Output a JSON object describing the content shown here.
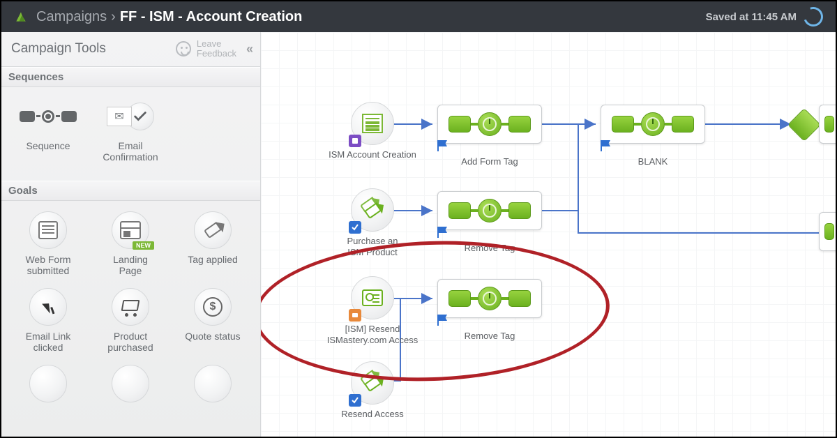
{
  "header": {
    "breadcrumb_root": "Campaigns",
    "breadcrumb_sep": "›",
    "title": "FF - ISM - Account Creation",
    "saved_text": "Saved at 11:45 AM"
  },
  "sidebar": {
    "title": "Campaign Tools",
    "feedback_label": "Leave\nFeedback",
    "sections": {
      "sequences": {
        "label": "Sequences",
        "items": [
          {
            "name": "sequence",
            "label": "Sequence"
          },
          {
            "name": "email-confirmation",
            "label": "Email\nConfirmation"
          }
        ]
      },
      "goals": {
        "label": "Goals",
        "items": [
          {
            "name": "web-form-submitted",
            "label": "Web Form\nsubmitted"
          },
          {
            "name": "landing-page",
            "label": "Landing\nPage",
            "badge": "NEW"
          },
          {
            "name": "tag-applied",
            "label": "Tag applied"
          },
          {
            "name": "email-link-clicked",
            "label": "Email Link\nclicked"
          },
          {
            "name": "product-purchased",
            "label": "Product\npurchased"
          },
          {
            "name": "quote-status",
            "label": "Quote status"
          }
        ]
      }
    }
  },
  "canvas": {
    "nodes": {
      "ism_account_creation": {
        "label": "ISM Account Creation",
        "badge": "purple"
      },
      "add_form_tag": {
        "label": "Add Form Tag"
      },
      "blank": {
        "label": "BLANK"
      },
      "purchase_ism_product": {
        "label": "Purchase an\nISM Product",
        "badge": "blue"
      },
      "remove_tag_1": {
        "label": "Remove Tag"
      },
      "ism_resend_access": {
        "label": "[ISM] Resend\nISMastery.com Access",
        "badge": "orange"
      },
      "remove_tag_2": {
        "label": "Remove Tag"
      },
      "resend_access": {
        "label": "Resend Access",
        "badge": "blue"
      }
    }
  }
}
